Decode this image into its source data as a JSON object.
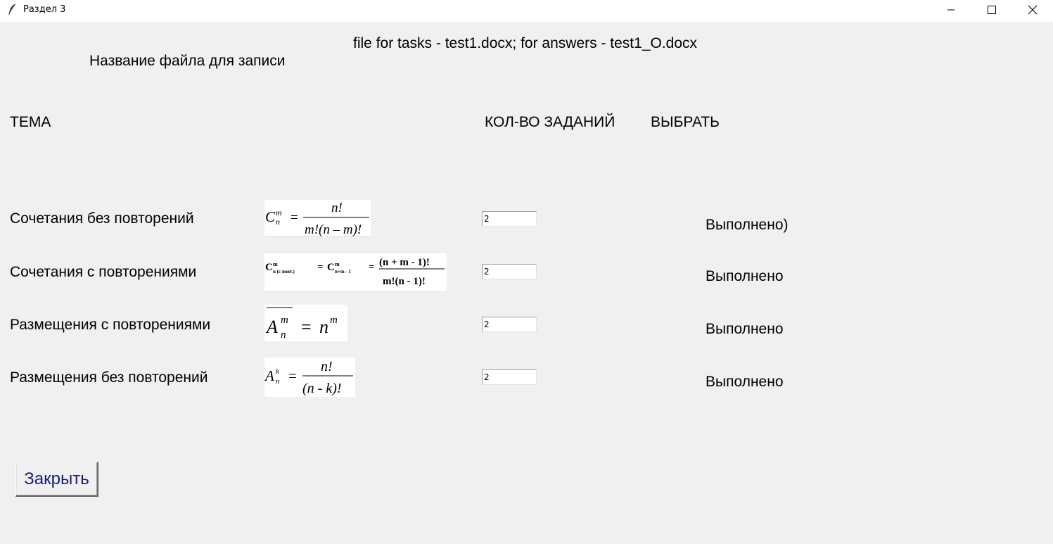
{
  "window": {
    "title": "Раздел 3",
    "icon": "feather-icon"
  },
  "header": {
    "file_info": "file for tasks - test1.docx; for answers - test1_O.docx",
    "file_label": "Название файла для записи"
  },
  "columns": {
    "topic": "ТЕМА",
    "count": "КОЛ-ВО ЗАДАНИЙ",
    "select": "ВЫБРАТЬ"
  },
  "rows": [
    {
      "topic": "Сочетания без повторений",
      "count": "2",
      "status": "Выполнено)"
    },
    {
      "topic": "Сочетания с повторениями",
      "count": "2",
      "status": "Выполнено"
    },
    {
      "topic": "Размещения с повторениями",
      "count": "2",
      "status": "Выполнено"
    },
    {
      "topic": "Размещения без повторений",
      "count": "2",
      "status": "Выполнено"
    }
  ],
  "formulas": {
    "f1": {
      "lhs_base": "C",
      "lhs_sup": "m",
      "lhs_sub": "n",
      "eq": "=",
      "num": "n!",
      "den": "m!(n – m)!"
    },
    "f2": {
      "c1": "C",
      "c1_sup": "m",
      "c1_sub": "n (с повт.)",
      "eq1": "=",
      "c2": "C",
      "c2_sup": "m",
      "c2_sub": "n+m - 1",
      "eq2": "=",
      "num": "(n + m - 1)!",
      "den": "m!(n - 1)!"
    },
    "f3": {
      "base": "A",
      "sup": "m",
      "sub": "n",
      "eq": "=",
      "rhs": "n",
      "rhs_sup": "m"
    },
    "f4": {
      "base": "A",
      "sup": "k",
      "sub": "n",
      "eq": "=",
      "num": "n!",
      "den": "(n -  k)!"
    }
  },
  "buttons": {
    "close": "Закрыть"
  }
}
